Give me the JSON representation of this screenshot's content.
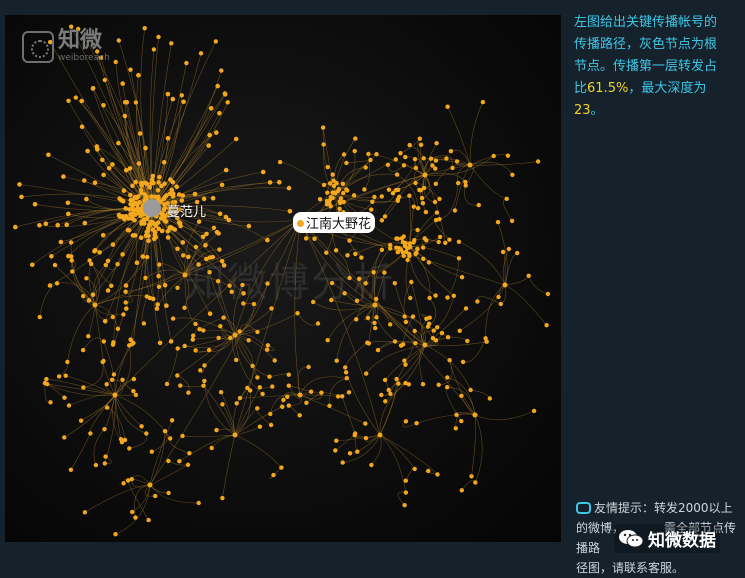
{
  "graph": {
    "watermark": "知微博分析",
    "root_label": "蔓范儿",
    "key_label": "江南大野花",
    "colors": {
      "node": "#f4a81d",
      "edge": "#a67c2a",
      "root": "#9a9a9a"
    }
  },
  "brand": {
    "name": "知微",
    "sub": "weiboreach"
  },
  "sidebar": {
    "line1": "左图给出关键传播帐号的",
    "line2": "传播路径，灰色节点为根",
    "line3": "节点。传播第一层转发占",
    "pct_prefix": "比",
    "pct_value": "61.5%",
    "pct_suffix": "，最大深度为",
    "depth_value": "23",
    "depth_suffix": "。"
  },
  "tip": {
    "line1": "友情提示：转发2000以上",
    "line2": "的微博，",
    "line3": "需全部节点传播路",
    "line4": "径图，请联系客服。"
  },
  "footer_badge": {
    "label": "知微数据",
    "icon": "wechat-icon"
  }
}
